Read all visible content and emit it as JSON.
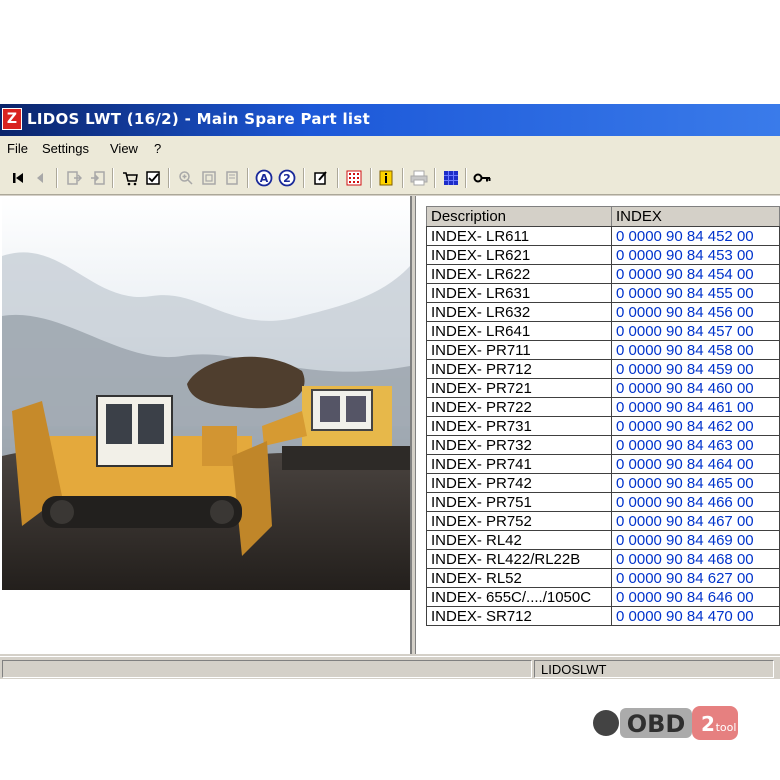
{
  "window": {
    "title": "LIDOS LWT (16/2) - Main Spare Part list",
    "icon": "lidos-app-icon",
    "accent": "#0a246a"
  },
  "menu": [
    {
      "label": "File"
    },
    {
      "label": "Settings"
    },
    {
      "label": "View"
    },
    {
      "label": "?"
    }
  ],
  "toolbar": [
    {
      "icon": "first-record-icon"
    },
    {
      "icon": "previous-record-icon"
    },
    {
      "icon": "export-icon"
    },
    {
      "icon": "import-icon"
    },
    {
      "icon": "cart-icon"
    },
    {
      "icon": "checklist-icon"
    },
    {
      "icon": "zoom-in-icon"
    },
    {
      "icon": "page-fit-icon"
    },
    {
      "icon": "page-icon"
    },
    {
      "icon": "circle-a-icon"
    },
    {
      "icon": "circle-2-icon"
    },
    {
      "icon": "edit-icon"
    },
    {
      "icon": "grid-red-icon"
    },
    {
      "icon": "info-icon"
    },
    {
      "icon": "print-icon"
    },
    {
      "icon": "blue-grid-icon"
    },
    {
      "icon": "key-icon"
    }
  ],
  "table": {
    "headers": {
      "description": "Description",
      "index": "INDEX"
    },
    "rows": [
      {
        "description": "INDEX- LR611",
        "index": "0 0000  90 84 452 00"
      },
      {
        "description": "INDEX- LR621",
        "index": "0 0000  90 84 453 00"
      },
      {
        "description": "INDEX- LR622",
        "index": "0 0000  90 84 454 00"
      },
      {
        "description": "INDEX- LR631",
        "index": "0 0000  90 84 455 00"
      },
      {
        "description": "INDEX- LR632",
        "index": "0 0000  90 84 456 00"
      },
      {
        "description": "INDEX- LR641",
        "index": "0 0000  90 84 457 00"
      },
      {
        "description": "INDEX- PR711",
        "index": "0 0000  90 84 458 00"
      },
      {
        "description": "INDEX- PR712",
        "index": "0 0000  90 84 459 00"
      },
      {
        "description": "INDEX- PR721",
        "index": "0 0000  90 84 460 00"
      },
      {
        "description": "INDEX- PR722",
        "index": "0 0000  90 84 461 00"
      },
      {
        "description": "INDEX- PR731",
        "index": "0 0000  90 84 462 00"
      },
      {
        "description": "INDEX- PR732",
        "index": "0 0000  90 84 463 00"
      },
      {
        "description": "INDEX- PR741",
        "index": "0 0000  90 84 464 00"
      },
      {
        "description": "INDEX- PR742",
        "index": "0 0000  90 84 465 00"
      },
      {
        "description": "INDEX- PR751",
        "index": "0 0000  90 84 466 00"
      },
      {
        "description": "INDEX- PR752",
        "index": "0 0000  90 84 467 00"
      },
      {
        "description": "INDEX- RL42",
        "index": "0 0000  90 84 469 00"
      },
      {
        "description": "INDEX- RL422/RL22B",
        "index": "0 0000  90 84 468 00"
      },
      {
        "description": "INDEX- RL52",
        "index": "0 0000  90 84 627 00"
      },
      {
        "description": "INDEX- 655C/..../1050C",
        "index": "0 0000  90 84 646 00"
      },
      {
        "description": "INDEX- SR712",
        "index": "0 0000  90 84 470 00"
      }
    ]
  },
  "status": {
    "text": "LIDOSLWT"
  },
  "watermark": {
    "left": "OBD",
    "right": "2",
    "right_small": "tool"
  }
}
